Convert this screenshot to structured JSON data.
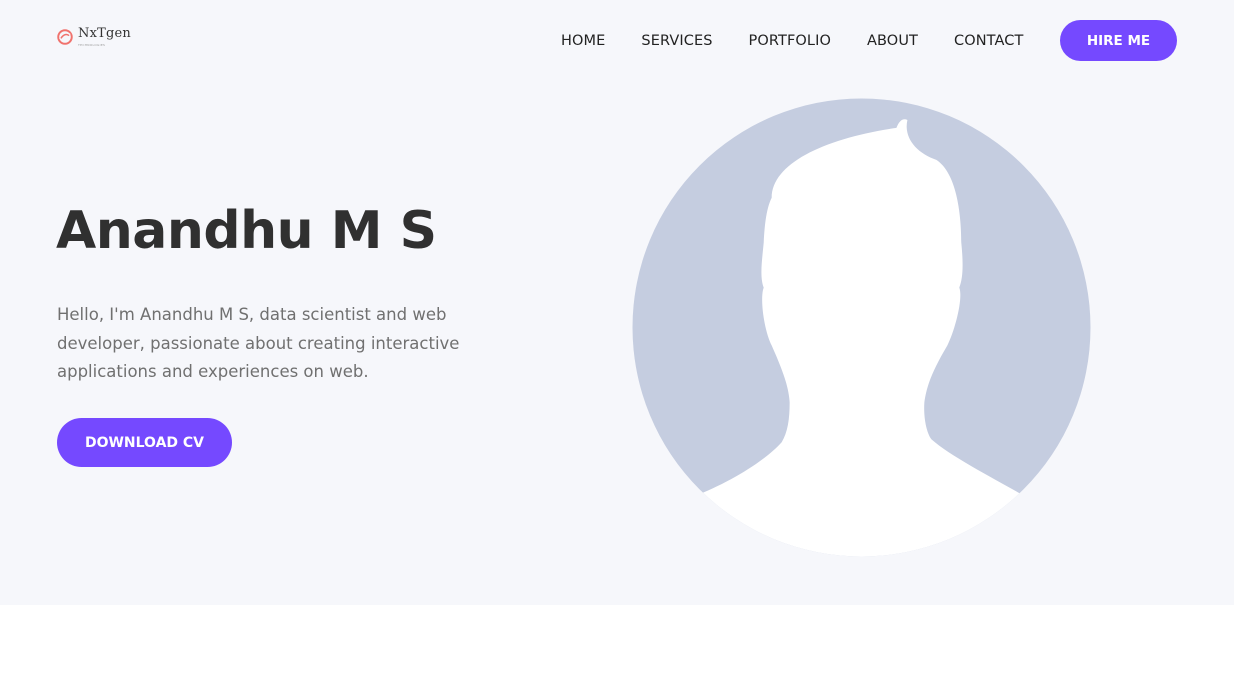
{
  "brand": {
    "name": "NxTgen",
    "tagline": "TECHNOLOGIES",
    "logo_icon": "swirl-logo-icon",
    "color": "#f0726d"
  },
  "nav": {
    "links": [
      "HOME",
      "SERVICES",
      "PORTFOLIO",
      "ABOUT",
      "CONTACT"
    ],
    "cta_label": "HIRE ME"
  },
  "hero": {
    "title": "Anandhu M S",
    "description": "Hello, I'm Anandhu M S, data scientist and web developer, passionate about creating interactive applications and experiences on web.",
    "cta_label": "DOWNLOAD CV",
    "avatar_icon": "person-silhouette-icon"
  },
  "colors": {
    "accent": "#7549ff",
    "hero_background": "#f6f7fb",
    "avatar_background": "#c5cde0",
    "heading": "#303030",
    "body_text": "#707070"
  }
}
